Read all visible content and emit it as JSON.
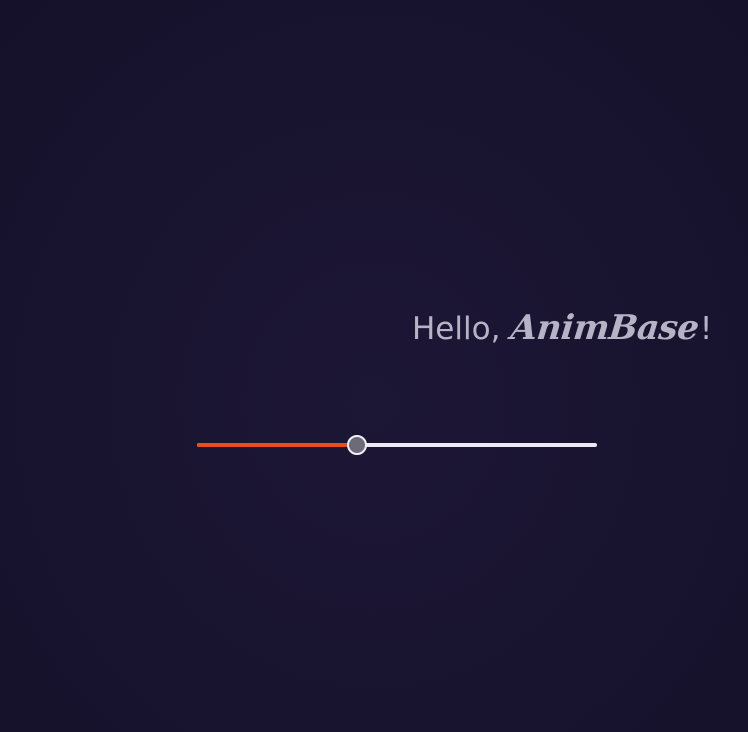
{
  "greeting": {
    "prefix": "Hello, ",
    "brand": "AnimBase",
    "suffix": "!"
  },
  "slider": {
    "value": 0.4,
    "fill_color": "#ea4e1d",
    "track_color": "#ece9f2",
    "thumb_color": "#6e6b79"
  },
  "colors": {
    "background": "#191430",
    "text": "#b7b3c6"
  }
}
